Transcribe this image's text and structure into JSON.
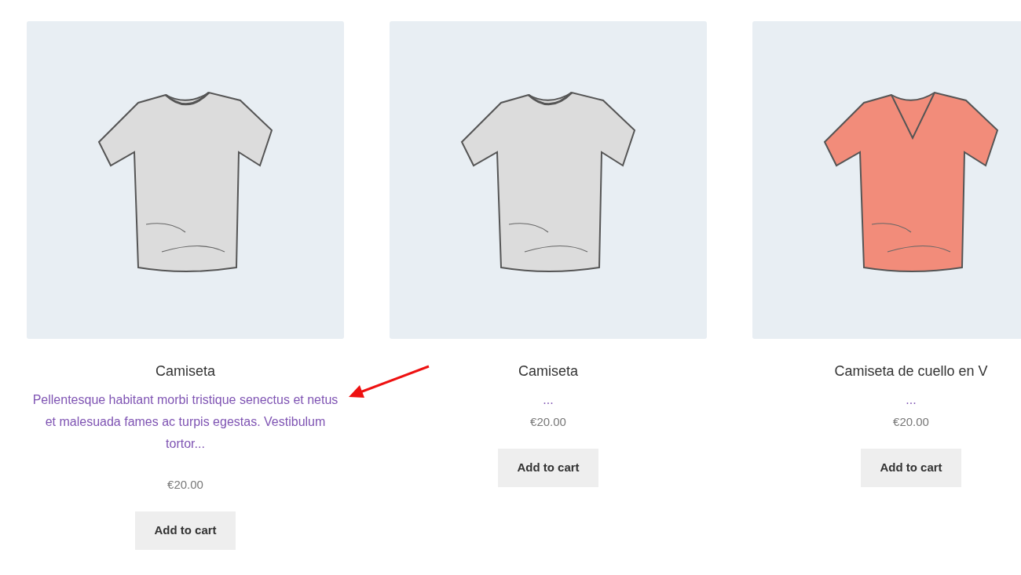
{
  "products": [
    {
      "title": "Camiseta",
      "excerpt": "Pellentesque habitant morbi tristique senectus et netus et malesuada fames ac turpis egestas. Vestibulum tortor...",
      "kind": "long",
      "price": "€20.00",
      "button": "Add to cart",
      "shirt": {
        "kind": "crew",
        "color": "#dcdcdc"
      }
    },
    {
      "title": "Camiseta",
      "excerpt": "...",
      "kind": "short",
      "price": "€20.00",
      "button": "Add to cart",
      "shirt": {
        "kind": "crew",
        "color": "#dcdcdc"
      }
    },
    {
      "title": "Camiseta de cuello en V",
      "excerpt": "...",
      "kind": "short",
      "price": "€20.00",
      "button": "Add to cart",
      "shirt": {
        "kind": "vneck",
        "color": "#f28c7a"
      }
    }
  ]
}
